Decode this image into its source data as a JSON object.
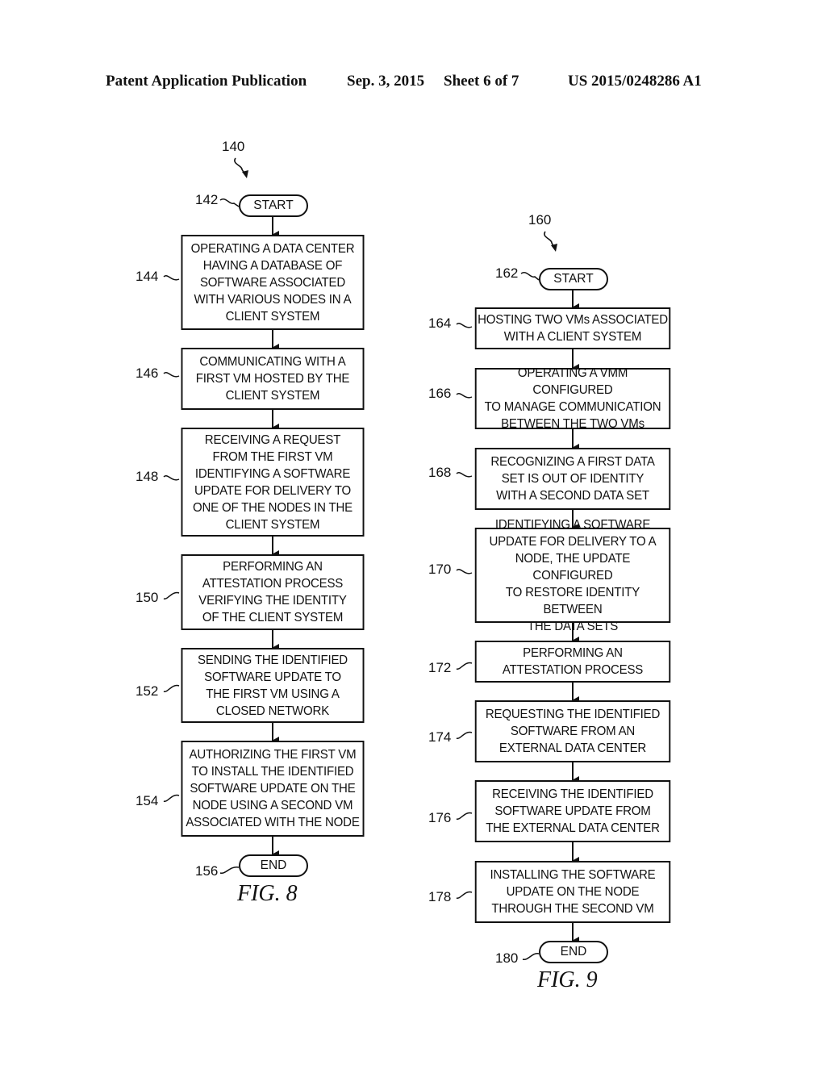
{
  "header": {
    "left": "Patent Application Publication",
    "date": "Sep. 3, 2015",
    "sheet": "Sheet 6 of 7",
    "pub_number": "US 2015/0248286 A1"
  },
  "fig8": {
    "ref": "140",
    "caption": "FIG. 8",
    "start": {
      "ref": "142",
      "label": "START"
    },
    "steps": [
      {
        "ref": "144",
        "text": "OPERATING A DATA CENTER\nHAVING A DATABASE OF\nSOFTWARE ASSOCIATED\nWITH VARIOUS NODES IN A\nCLIENT SYSTEM"
      },
      {
        "ref": "146",
        "text": "COMMUNICATING WITH A\nFIRST VM HOSTED BY THE\nCLIENT SYSTEM"
      },
      {
        "ref": "148",
        "text": "RECEIVING A REQUEST\nFROM THE FIRST VM\nIDENTIFYING A SOFTWARE\nUPDATE FOR DELIVERY TO\nONE OF THE NODES IN THE\nCLIENT SYSTEM"
      },
      {
        "ref": "150",
        "text": "PERFORMING AN\nATTESTATION PROCESS\nVERIFYING THE IDENTITY\nOF THE CLIENT SYSTEM"
      },
      {
        "ref": "152",
        "text": "SENDING THE IDENTIFIED\nSOFTWARE UPDATE TO\nTHE FIRST VM USING A\nCLOSED NETWORK"
      },
      {
        "ref": "154",
        "text": "AUTHORIZING THE FIRST VM\nTO INSTALL THE IDENTIFIED\nSOFTWARE UPDATE ON THE\nNODE USING A SECOND VM\nASSOCIATED WITH THE NODE"
      }
    ],
    "end": {
      "ref": "156",
      "label": "END"
    }
  },
  "fig9": {
    "ref": "160",
    "caption": "FIG. 9",
    "start": {
      "ref": "162",
      "label": "START"
    },
    "steps": [
      {
        "ref": "164",
        "text": "HOSTING TWO VMs ASSOCIATED\nWITH A CLIENT SYSTEM"
      },
      {
        "ref": "166",
        "text": "OPERATING A VMM CONFIGURED\nTO MANAGE COMMUNICATION\nBETWEEN THE TWO VMs"
      },
      {
        "ref": "168",
        "text": "RECOGNIZING A FIRST DATA\nSET IS OUT OF IDENTITY\nWITH A SECOND DATA SET"
      },
      {
        "ref": "170",
        "text": "IDENTIFYING A SOFTWARE\nUPDATE FOR DELIVERY TO A\nNODE, THE UPDATE CONFIGURED\nTO RESTORE IDENTITY BETWEEN\nTHE DATA SETS"
      },
      {
        "ref": "172",
        "text": "PERFORMING AN\nATTESTATION PROCESS"
      },
      {
        "ref": "174",
        "text": "REQUESTING THE IDENTIFIED\nSOFTWARE FROM AN\nEXTERNAL DATA CENTER"
      },
      {
        "ref": "176",
        "text": "RECEIVING THE IDENTIFIED\nSOFTWARE UPDATE FROM\nTHE EXTERNAL DATA CENTER"
      },
      {
        "ref": "178",
        "text": "INSTALLING THE SOFTWARE\nUPDATE ON THE NODE\nTHROUGH THE SECOND VM"
      }
    ],
    "end": {
      "ref": "180",
      "label": "END"
    }
  }
}
